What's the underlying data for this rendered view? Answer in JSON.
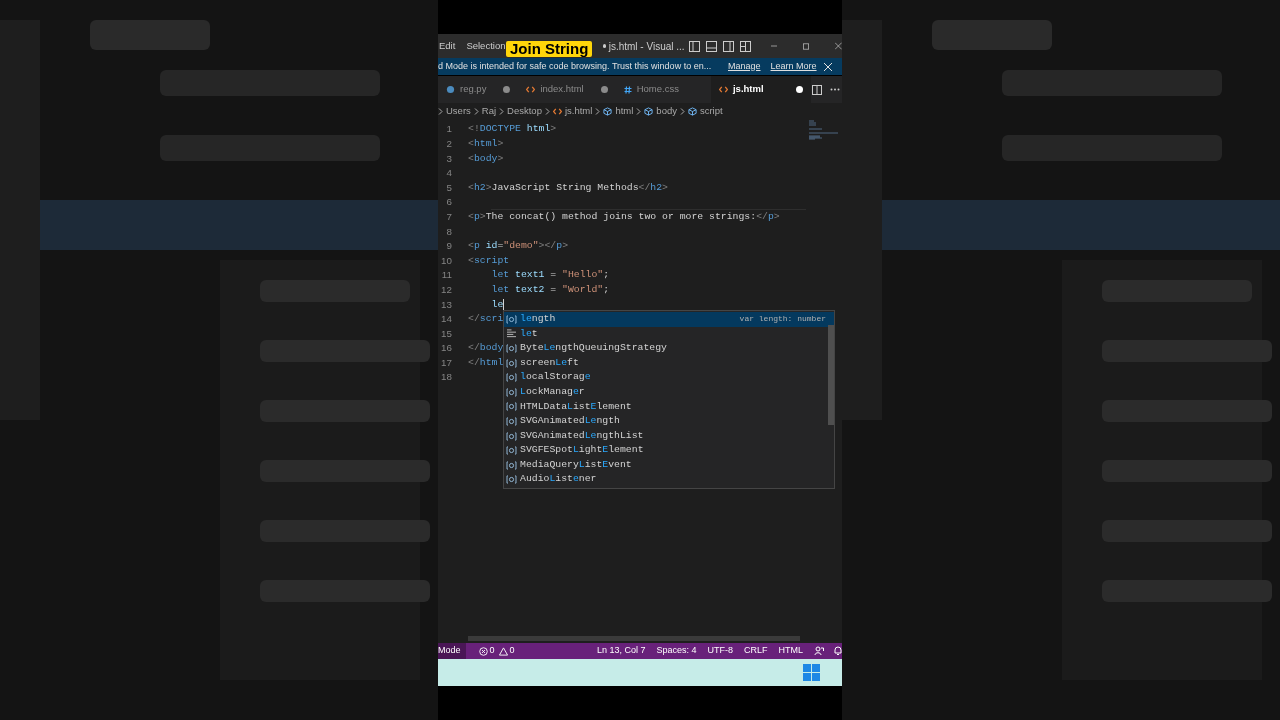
{
  "overlay_caption": "Join String",
  "title_bar": {
    "menu": [
      "Edit",
      "Selection"
    ],
    "title": "js.html - Visual ...",
    "dirty": true
  },
  "banner": {
    "text": "d Mode is intended for safe code browsing. Trust this window to en...",
    "links": [
      "Manage",
      "Learn More"
    ]
  },
  "tabs": [
    {
      "label": "reg.py",
      "kind": "python",
      "dirty": true,
      "selected": false
    },
    {
      "label": "index.html",
      "kind": "html",
      "dirty": true,
      "selected": false
    },
    {
      "label": "Home.css",
      "kind": "css",
      "dirty": false,
      "selected": false
    },
    {
      "label": "js.html",
      "kind": "html",
      "dirty": true,
      "selected": true
    }
  ],
  "breadcrumb": [
    {
      "label": "Users",
      "kind": "folder"
    },
    {
      "label": "Raj",
      "kind": "folder"
    },
    {
      "label": "Desktop",
      "kind": "folder"
    },
    {
      "label": "js.html",
      "kind": "html"
    },
    {
      "label": "html",
      "kind": "symbol"
    },
    {
      "label": "body",
      "kind": "symbol"
    },
    {
      "label": "script",
      "kind": "symbol"
    }
  ],
  "code_lines": [
    {
      "number": "1",
      "has_cursor": false,
      "tokens": [
        {
          "kind": "bracket",
          "text": "<!"
        },
        {
          "kind": "tag",
          "text": "DOCTYPE"
        },
        {
          "kind": "attr",
          "text": " html"
        },
        {
          "kind": "bracket",
          "text": ">"
        }
      ]
    },
    {
      "number": "2",
      "has_cursor": false,
      "tokens": [
        {
          "kind": "bracket",
          "text": "<"
        },
        {
          "kind": "tag",
          "text": "html"
        },
        {
          "kind": "bracket",
          "text": ">"
        }
      ]
    },
    {
      "number": "3",
      "has_cursor": false,
      "tokens": [
        {
          "kind": "bracket",
          "text": "<"
        },
        {
          "kind": "tag",
          "text": "body"
        },
        {
          "kind": "bracket",
          "text": ">"
        }
      ]
    },
    {
      "number": "4",
      "has_cursor": false
    },
    {
      "number": "5",
      "has_cursor": false,
      "tokens": [
        {
          "kind": "bracket",
          "text": "<"
        },
        {
          "kind": "tag",
          "text": "h2"
        },
        {
          "kind": "bracket",
          "text": ">"
        },
        {
          "kind": "plain",
          "text": "JavaScript String Methods"
        },
        {
          "kind": "bracket",
          "text": "</"
        },
        {
          "kind": "tag",
          "text": "h2"
        },
        {
          "kind": "bracket",
          "text": ">"
        }
      ]
    },
    {
      "number": "6",
      "has_cursor": false
    },
    {
      "number": "7",
      "has_cursor": false,
      "tokens": [
        {
          "kind": "bracket",
          "text": "<"
        },
        {
          "kind": "tag",
          "text": "p"
        },
        {
          "kind": "bracket",
          "text": ">"
        },
        {
          "kind": "plain",
          "text": "The concat() method joins two or more strings:"
        },
        {
          "kind": "bracket",
          "text": "</"
        },
        {
          "kind": "tag",
          "text": "p"
        },
        {
          "kind": "bracket",
          "text": ">"
        }
      ]
    },
    {
      "number": "8",
      "has_cursor": false
    },
    {
      "number": "9",
      "has_cursor": false,
      "tokens": [
        {
          "kind": "bracket",
          "text": "<"
        },
        {
          "kind": "tag",
          "text": "p"
        },
        {
          "kind": "attr",
          "text": " id"
        },
        {
          "kind": "plain",
          "text": "="
        },
        {
          "kind": "string",
          "text": "\"demo\""
        },
        {
          "kind": "bracket",
          "text": "></"
        },
        {
          "kind": "tag",
          "text": "p"
        },
        {
          "kind": "bracket",
          "text": ">"
        }
      ]
    },
    {
      "number": "10",
      "has_cursor": false,
      "tokens": [
        {
          "kind": "bracket",
          "text": "<"
        },
        {
          "kind": "tag",
          "text": "script"
        }
      ]
    },
    {
      "number": "11",
      "has_cursor": false,
      "tokens": [
        {
          "kind": "tag",
          "text": "    let"
        },
        {
          "kind": "attr",
          "text": " text1"
        },
        {
          "kind": "plain",
          "text": " = "
        },
        {
          "kind": "string",
          "text": "\"Hello\""
        },
        {
          "kind": "plain",
          "text": ";"
        }
      ]
    },
    {
      "number": "12",
      "has_cursor": false,
      "tokens": [
        {
          "kind": "tag",
          "text": "    let"
        },
        {
          "kind": "attr",
          "text": " text2"
        },
        {
          "kind": "plain",
          "text": " = "
        },
        {
          "kind": "string",
          "text": "\"World\""
        },
        {
          "kind": "plain",
          "text": ";"
        }
      ]
    },
    {
      "number": "13",
      "has_cursor": true,
      "tokens": [
        {
          "kind": "attr",
          "text": "    le"
        }
      ]
    },
    {
      "number": "14",
      "has_cursor": false,
      "tokens": [
        {
          "kind": "bracket",
          "text": "</"
        },
        {
          "kind": "tag",
          "text": "scri"
        }
      ]
    },
    {
      "number": "15",
      "has_cursor": false
    },
    {
      "number": "16",
      "has_cursor": false,
      "tokens": [
        {
          "kind": "bracket",
          "text": "</"
        },
        {
          "kind": "tag",
          "text": "body"
        }
      ]
    },
    {
      "number": "17",
      "has_cursor": false,
      "tokens": [
        {
          "kind": "bracket",
          "text": "</"
        },
        {
          "kind": "tag",
          "text": "html"
        }
      ]
    },
    {
      "number": "18",
      "has_cursor": false
    }
  ],
  "suggestions": [
    {
      "kind": "variable",
      "selected": true,
      "detail": "var length: number",
      "parts": [
        {
          "text": "le",
          "match": true
        },
        {
          "text": "ngth",
          "match": false
        }
      ]
    },
    {
      "kind": "keyword",
      "selected": false,
      "parts": [
        {
          "text": "le",
          "match": true
        },
        {
          "text": "t",
          "match": false
        }
      ]
    },
    {
      "kind": "variable",
      "selected": false,
      "parts": [
        {
          "text": "Byte",
          "match": false
        },
        {
          "text": "Le",
          "match": true
        },
        {
          "text": "ngthQueuingStrategy",
          "match": false
        }
      ]
    },
    {
      "kind": "variable",
      "selected": false,
      "parts": [
        {
          "text": "screen",
          "match": false
        },
        {
          "text": "Le",
          "match": true
        },
        {
          "text": "ft",
          "match": false
        }
      ]
    },
    {
      "kind": "variable",
      "selected": false,
      "parts": [
        {
          "text": "l",
          "match": true
        },
        {
          "text": "ocalStorag",
          "match": false
        },
        {
          "text": "e",
          "match": true
        }
      ]
    },
    {
      "kind": "variable",
      "selected": false,
      "parts": [
        {
          "text": "L",
          "match": true
        },
        {
          "text": "ockManag",
          "match": false
        },
        {
          "text": "e",
          "match": true
        },
        {
          "text": "r",
          "match": false
        }
      ]
    },
    {
      "kind": "variable",
      "selected": false,
      "parts": [
        {
          "text": "HTMLData",
          "match": false
        },
        {
          "text": "L",
          "match": true
        },
        {
          "text": "ist",
          "match": false
        },
        {
          "text": "E",
          "match": true
        },
        {
          "text": "lement",
          "match": false
        }
      ]
    },
    {
      "kind": "variable",
      "selected": false,
      "parts": [
        {
          "text": "SVGAnimated",
          "match": false
        },
        {
          "text": "Le",
          "match": true
        },
        {
          "text": "ngth",
          "match": false
        }
      ]
    },
    {
      "kind": "variable",
      "selected": false,
      "parts": [
        {
          "text": "SVGAnimated",
          "match": false
        },
        {
          "text": "Le",
          "match": true
        },
        {
          "text": "ngthList",
          "match": false
        }
      ]
    },
    {
      "kind": "variable",
      "selected": false,
      "parts": [
        {
          "text": "SVGFESpot",
          "match": false
        },
        {
          "text": "L",
          "match": true
        },
        {
          "text": "ight",
          "match": false
        },
        {
          "text": "E",
          "match": true
        },
        {
          "text": "lement",
          "match": false
        }
      ]
    },
    {
      "kind": "variable",
      "selected": false,
      "parts": [
        {
          "text": "MediaQuery",
          "match": false
        },
        {
          "text": "L",
          "match": true
        },
        {
          "text": "ist",
          "match": false
        },
        {
          "text": "E",
          "match": true
        },
        {
          "text": "vent",
          "match": false
        }
      ]
    },
    {
      "kind": "variable",
      "selected": false,
      "parts": [
        {
          "text": "Audio",
          "match": false
        },
        {
          "text": "L",
          "match": true
        },
        {
          "text": "ist",
          "match": false
        },
        {
          "text": "e",
          "match": true
        },
        {
          "text": "ner",
          "match": false
        }
      ]
    }
  ],
  "status_bar": {
    "mode": "Mode",
    "errors": "0",
    "warnings": "0",
    "items": [
      "Ln 13, Col 7",
      "Spaces: 4",
      "UTF-8",
      "CRLF",
      "HTML"
    ]
  }
}
